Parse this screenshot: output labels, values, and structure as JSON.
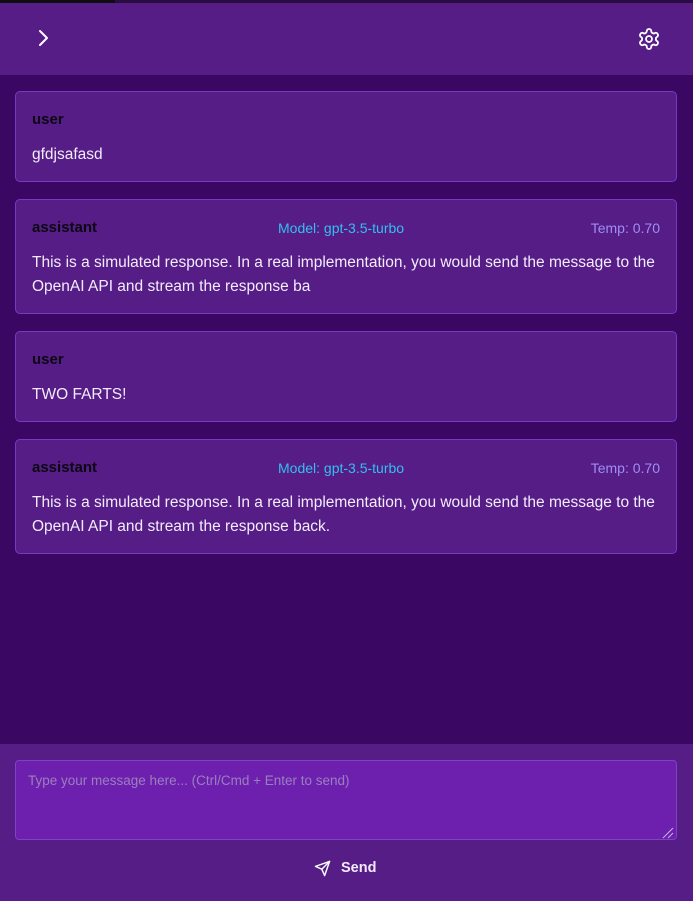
{
  "header": {
    "toggle_icon": "chevron-right-icon",
    "settings_icon": "gear-icon"
  },
  "messages": [
    {
      "role": "user",
      "content": "gfdjsafasd"
    },
    {
      "role": "assistant",
      "model": "Model: gpt-3.5-turbo",
      "temp": "Temp: 0.70",
      "content": "This is a simulated response. In a real implementation, you would send the message to the OpenAI API and stream the response ba"
    },
    {
      "role": "user",
      "content": "TWO FARTS!"
    },
    {
      "role": "assistant",
      "model": "Model: gpt-3.5-turbo",
      "temp": "Temp: 0.70",
      "content": "This is a simulated response. In a real implementation, you would send the message to the OpenAI API and stream the response back."
    }
  ],
  "composer": {
    "placeholder": "Type your message here... (Ctrl/Cmd + Enter to send)",
    "value": "",
    "send_label": "Send",
    "send_icon": "send-icon"
  },
  "colors": {
    "background": "#3a0862",
    "panel": "#561d87",
    "input": "#6d20ad",
    "model_text": "#33bff0",
    "temp_text": "#9f8ef2"
  }
}
